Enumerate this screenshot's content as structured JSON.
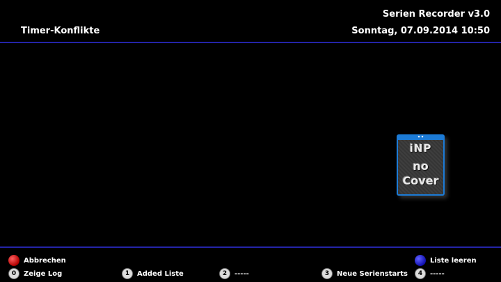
{
  "header": {
    "app_title": "Serien Recorder v3.0",
    "screen_title": "Timer-Konflikte",
    "datetime": "Sonntag, 07.09.2014  10:50"
  },
  "cover": {
    "line1": "iNP",
    "line2": "no",
    "line3": "Cover"
  },
  "footer": {
    "red_label": "Abbrechen",
    "blue_label": "Liste leeren",
    "keys": [
      {
        "number": "0",
        "label": "Zeige Log"
      },
      {
        "number": "1",
        "label": "Added Liste"
      },
      {
        "number": "2",
        "label": "-----"
      },
      {
        "number": "3",
        "label": "Neue Serienstarts"
      },
      {
        "number": "4",
        "label": "-----"
      }
    ]
  },
  "colors": {
    "separator": "#2424a8",
    "red_button": "#c00000",
    "blue_button": "#1a1ac8"
  }
}
